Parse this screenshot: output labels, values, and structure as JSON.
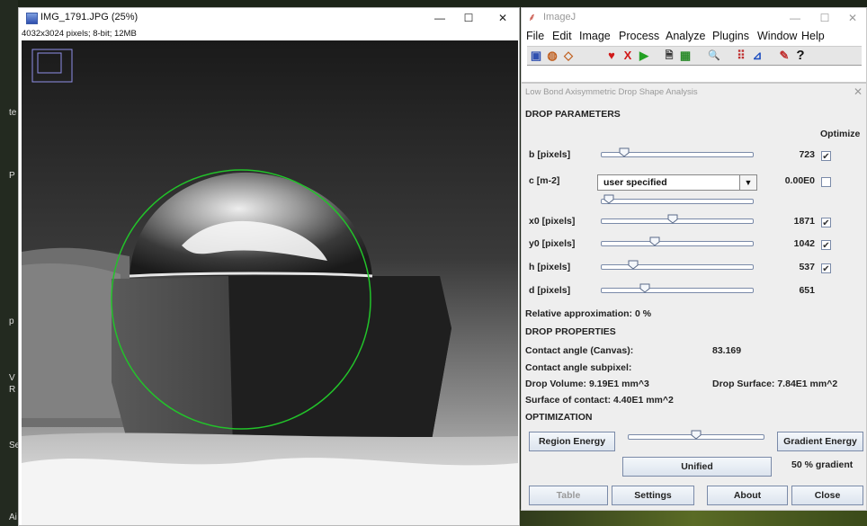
{
  "background": {
    "left_letters": [
      "te",
      "P",
      "p",
      "V",
      "R",
      "Se",
      "Ai"
    ]
  },
  "image_window": {
    "title": "IMG_1791.JPG (25%)",
    "info": "4032x3024 pixels; 8-bit; 12MB",
    "controls": {
      "minimize": "—",
      "maximize": "☐",
      "close": "✕"
    },
    "overlay_color": "#22c32a"
  },
  "imagej": {
    "title": "ImageJ",
    "controls": {
      "minimize": "—",
      "maximize": "☐",
      "close": "✕"
    },
    "menu": [
      "File",
      "Edit",
      "Image",
      "Process",
      "Analyze",
      "Plugins",
      "Window",
      "Help"
    ],
    "tools": [
      "rect-roi",
      "oval-roi",
      "polygon-roi",
      "heart",
      "x-mark",
      "play",
      "text-doc",
      "lut",
      "magnifier",
      "color-picker",
      "dropper",
      "edit-roi",
      "question"
    ],
    "tool_glyphs": [
      "▣",
      "◍",
      "◇",
      "♥",
      "X",
      "▶",
      "🗎",
      "▦",
      "🔍",
      "⠿",
      "⊿",
      "✎",
      "?"
    ]
  },
  "panel": {
    "title": "Low Bond Axisymmetric Drop Shape Analysis",
    "close": "✕",
    "drop_parameters_heading": "DROP PARAMETERS",
    "optimize_label": "Optimize",
    "params": [
      {
        "label": "b [pixels]",
        "value": "723",
        "slider": 0.15,
        "checked": true
      },
      {
        "label": "x0 [pixels]",
        "value": "1871",
        "slider": 0.47,
        "checked": true
      },
      {
        "label": "y0 [pixels]",
        "value": "1042",
        "slider": 0.35,
        "checked": true
      },
      {
        "label": "h [pixels]",
        "value": "537",
        "slider": 0.21,
        "checked": true
      },
      {
        "label": "d [pixels]",
        "value": "651",
        "slider": 0.29,
        "checked": false
      }
    ],
    "c_param": {
      "label": "c [m-2]",
      "select_value": "user specified",
      "value": "0.00E0",
      "checked": false,
      "slider": 0.05
    },
    "relative_approximation": "Relative approximation: 0 %",
    "drop_properties_heading": "DROP PROPERTIES",
    "contact_angle_canvas_label": "Contact angle (Canvas):",
    "contact_angle_canvas_value": "83.169",
    "contact_angle_subpixel_label": "Contact angle subpixel:",
    "drop_volume": "Drop Volume: 9.19E1 mm^3",
    "drop_surface": "Drop Surface: 7.84E1 mm^2",
    "surface_of_contact": "Surface of contact: 4.40E1 mm^2",
    "optimization_heading": "OPTIMIZATION",
    "region_energy_button": "Region Energy",
    "gradient_energy_button": "Gradient Energy",
    "optimization_slider": 0.5,
    "unified_button": "Unified",
    "gradient_percent": "50 % gradient",
    "table_button": "Table",
    "settings_button": "Settings",
    "about_button": "About",
    "close_button": "Close"
  }
}
